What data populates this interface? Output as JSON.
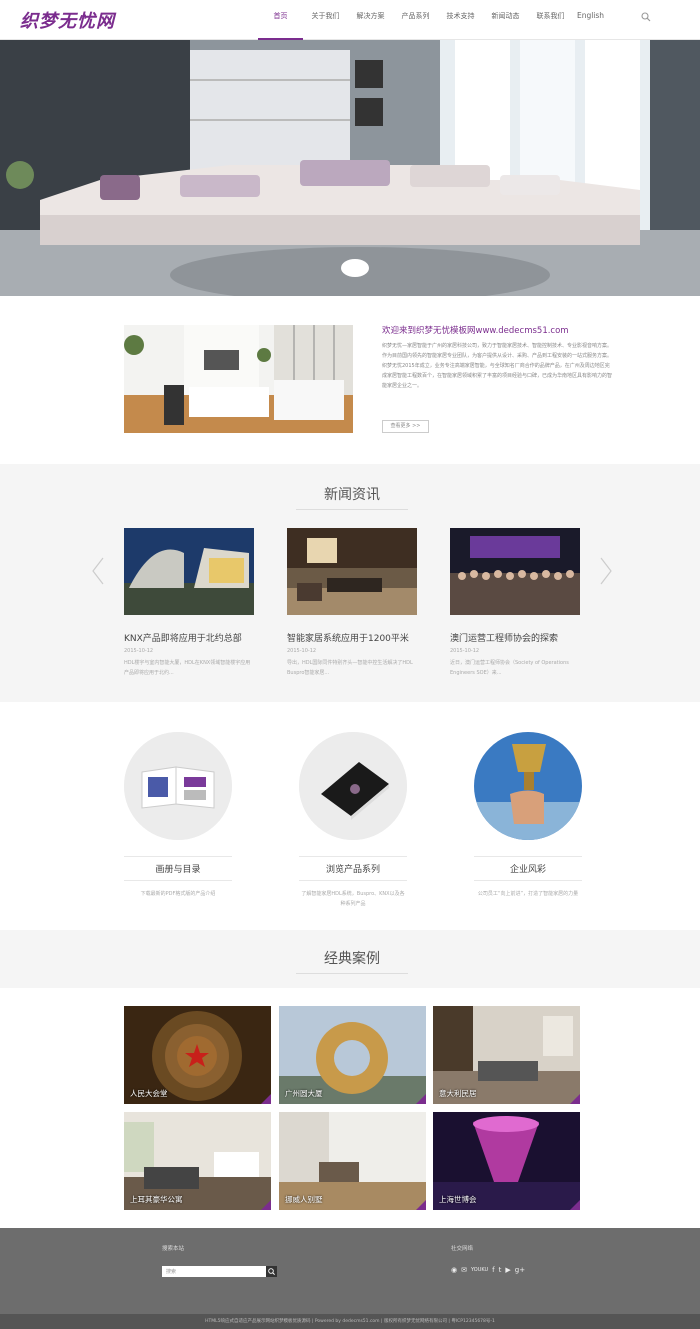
{
  "header": {
    "logo": "织梦无忧网",
    "nav": [
      "首页",
      "关于我们",
      "解决方案",
      "产品系列",
      "技术支持",
      "新闻动态",
      "联系我们",
      "English"
    ]
  },
  "about": {
    "title": "欢迎来到织梦无忧模板网www.dedecms51.com",
    "text": "织梦无忧—家居智能于广州的家居科技公司，致力于智能家居技术、智能控制技术、专业影视音响方案。作为目前国内领先的智能家居专业团队，为客户提供从设计、采购、产品到工程安装的一站式服务方案。织梦无忧2015年成立，业务专注高端家居智能，与全球知名厂商合作的品牌产品，在广州及周边地区完成家居智能工程数百个，在智能家居领域积累了丰富的项目经验与口碑，已成为华南地区具有影响力的智能家居企业之一。",
    "button": "查看更多 >>"
  },
  "news": {
    "title": "新闻资讯",
    "items": [
      {
        "title": "KNX产品即将应用于北约总部",
        "date": "2015-10-12",
        "summary": "HDL楼宇与室内智能大厦，HDL在KNX领域智能楼宇应用产品即将应用于北约..."
      },
      {
        "title": "智能家居系统应用于1200平米",
        "date": "2015-10-12",
        "summary": "导出，HDL国际同件特别齐头—智能中控生活解决了HDL Buspro智能家居..."
      },
      {
        "title": "澳门运营工程师协会的探索",
        "date": "2015-10-12",
        "summary": "近日，澳门运营工程师协会（Society of Operations Engineers SOE）来..."
      }
    ]
  },
  "services": [
    {
      "title": "画册与目录",
      "desc": "下载最新的PDF格式版的产品介绍"
    },
    {
      "title": "浏览产品系列",
      "desc": "了解智能家居HDL系统，Buspro、KNX以及各种系列产品"
    },
    {
      "title": "企业风彩",
      "desc": "公司员工“向上前进”，打造了智能家居的力量"
    }
  ],
  "cases": {
    "title": "经典案例",
    "items": [
      "人民大会堂",
      "广州圆大厦",
      "意大利民居",
      "上耳其豪华公寓",
      "挪威人别墅",
      "上海世博会"
    ]
  },
  "footer": {
    "search_label": "搜索本站",
    "search_placeholder": "搜索",
    "social_label": "社交网络",
    "copyright": "HTML5响应式自适应产品展示网站织梦模板优质源码 | Powered by dedecms51.com | 版权所有织梦无忧网络有限公司 | 粤ICP12345678号-1"
  },
  "colors": {
    "accent": "#7b2d8e",
    "footer_bg": "#6d6d6d"
  }
}
